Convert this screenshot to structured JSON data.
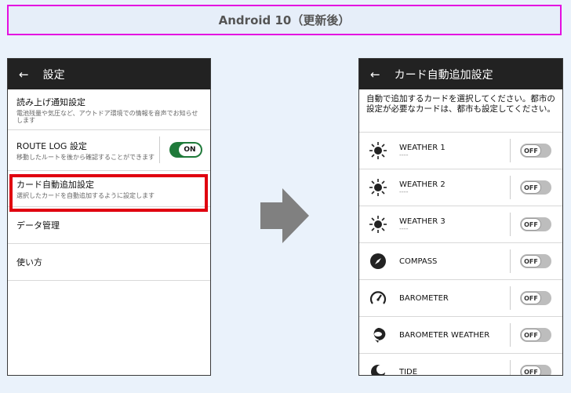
{
  "banner": {
    "title": "Android 10（更新後）"
  },
  "left": {
    "back_icon": "←",
    "title": "設定",
    "items": [
      {
        "title": "読み上げ通知設定",
        "sub": "電池残量や気圧など、アウトドア環境での情報を音声でお知らせします"
      },
      {
        "title": "ROUTE LOG 設定",
        "sub": "移動したルートを後から確認することができます",
        "toggle": "ON"
      },
      {
        "title": "カード自動追加設定",
        "sub": "選択したカードを自動追加するように設定します"
      },
      {
        "title": "データ管理"
      },
      {
        "title": "使い方"
      }
    ]
  },
  "right": {
    "back_icon": "←",
    "title": "カード自動追加設定",
    "description": "自動で追加するカードを選択してください。都市の設定が必要なカードは、都市も設定してください。",
    "cards": [
      {
        "name": "WEATHER 1",
        "sub": "----",
        "icon": "sun-icon",
        "toggle": "OFF"
      },
      {
        "name": "WEATHER 2",
        "sub": "----",
        "icon": "sun-icon",
        "toggle": "OFF"
      },
      {
        "name": "WEATHER 3",
        "sub": "----",
        "icon": "sun-icon",
        "toggle": "OFF"
      },
      {
        "name": "COMPASS",
        "sub": "",
        "icon": "compass-icon",
        "toggle": "OFF"
      },
      {
        "name": "BAROMETER",
        "sub": "",
        "icon": "gauge-icon",
        "toggle": "OFF"
      },
      {
        "name": "BAROMETER WEATHER",
        "sub": "",
        "icon": "cloud-bubble-icon",
        "toggle": "OFF"
      },
      {
        "name": "TIDE",
        "sub": "",
        "icon": "moon-icon",
        "toggle": "OFF"
      }
    ]
  },
  "colors": {
    "highlight": "#e0000f",
    "banner_border": "#e40fe0",
    "toggle_on": "#1f7a3a"
  }
}
